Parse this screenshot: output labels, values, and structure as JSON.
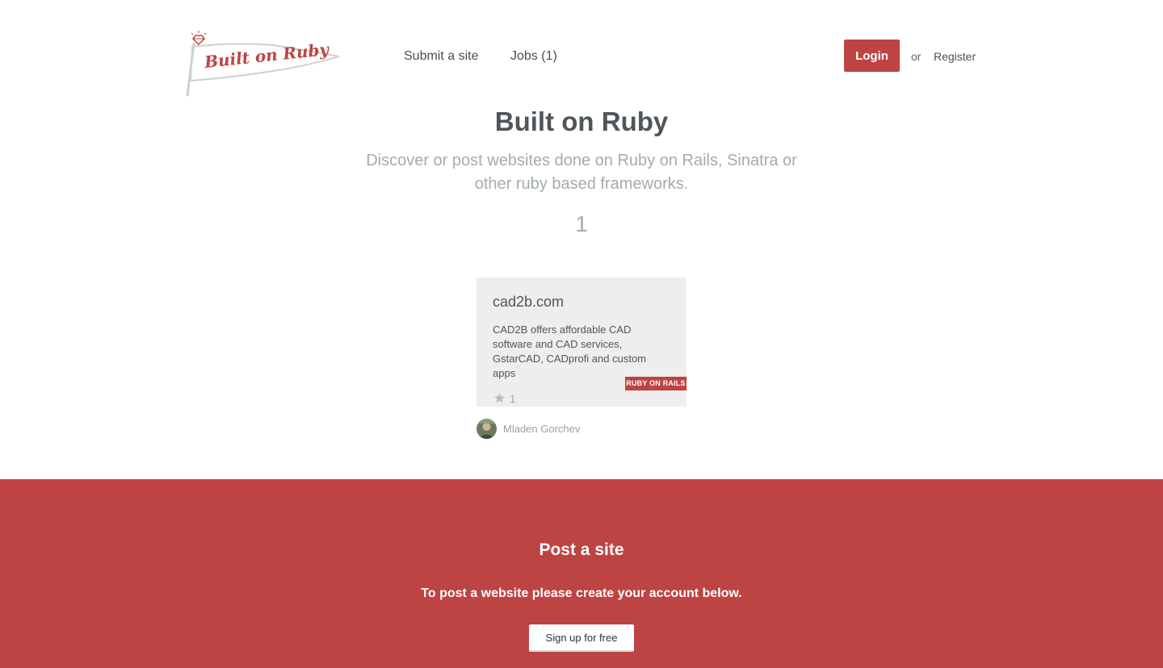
{
  "header": {
    "logo_text": "Built on Ruby",
    "nav": [
      {
        "label": "Submit a site"
      },
      {
        "label": "Jobs (1)"
      }
    ],
    "login_label": "Login",
    "or_text": "or",
    "register_label": "Register"
  },
  "hero": {
    "title": "Built on Ruby",
    "subtitle": "Discover or post websites done on Ruby on Rails, Sinatra or other ruby based frameworks.",
    "count": "1"
  },
  "sites": [
    {
      "title": "cad2b.com",
      "description": "CAD2B offers affordable CAD software and CAD services, GstarCAD, CADprofi and custom apps",
      "tag": "RUBY ON RAILS",
      "likes": "1",
      "author": "Mladen Gorchev"
    }
  ],
  "cta": {
    "title": "Post a site",
    "text": "To post a website please create your account below.",
    "button_label": "Sign up for free"
  },
  "colors": {
    "brand_red": "#be4343",
    "card_bg": "#eeeeee",
    "muted_text": "#a3abb0"
  },
  "icons": {
    "logo": "ruby-flag-logo",
    "star": "star-icon"
  }
}
